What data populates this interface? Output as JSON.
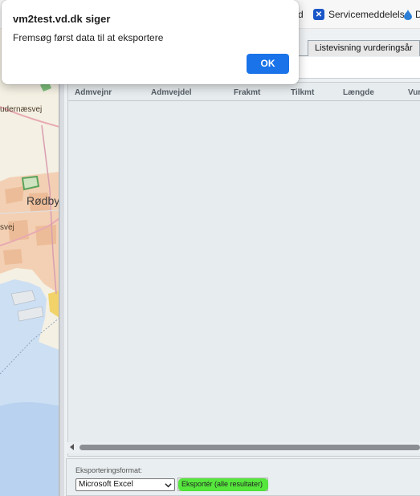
{
  "bookmarks": {
    "partial_label": "d",
    "service_label": "Servicemeddelelse",
    "service_icon": "blue-x-icon",
    "next_icon": "droplet-icon",
    "next_partial": "D"
  },
  "map": {
    "road_label_1": "udernæsvej",
    "town_label": "Rødby",
    "road_label_2": "svej"
  },
  "tabs": {
    "listevisning": "Listevisning vurderingsår"
  },
  "grid": {
    "columns": [
      "Admvejnr",
      "Admvejdel",
      "Frakmt",
      "Tilkmt",
      "Længde",
      "Vurd"
    ],
    "rows": []
  },
  "export": {
    "format_label": "Eksporteringsformat:",
    "format_value": "Microsoft Excel",
    "export_button": "Eksportér (alle resultater)",
    "highlight_color": "#3ce61e"
  },
  "dialog": {
    "title": "vm2test.vd.dk siger",
    "message": "Fremsøg først data til at eksportere",
    "ok": "OK",
    "accent": "#1a73e8"
  }
}
